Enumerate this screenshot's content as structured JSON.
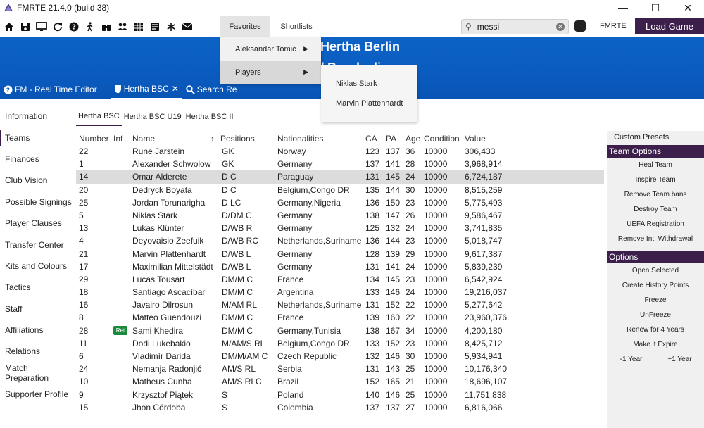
{
  "window": {
    "title": "FMRTE 21.4.0 (build 38)"
  },
  "toolbar": {
    "icons": [
      "home-icon",
      "save-icon",
      "monitor-icon",
      "refresh-icon",
      "help-icon",
      "person-walking-icon",
      "binoculars-icon",
      "group-icon",
      "grid-icon",
      "list-icon",
      "snowflake-icon",
      "mail-icon"
    ],
    "favorites_label": "Favorites",
    "shortlists_label": "Shortlists",
    "search_value": "messi",
    "fmrte_label": "FMRTE",
    "load_game_label": "Load Game"
  },
  "header": {
    "club_name": "Hertha Berlin",
    "league_name": "/ Bundesliga",
    "tabs": [
      {
        "label": "FM - Real Time Editor"
      },
      {
        "label": "Hertha BSC"
      },
      {
        "label": "Search Re"
      }
    ]
  },
  "favorites_menu": {
    "items": [
      {
        "label": "Aleksandar Tomić"
      },
      {
        "label": "Players"
      }
    ],
    "players_submenu": [
      {
        "label": "Niklas Stark"
      },
      {
        "label": "Marvin Plattenhardt"
      }
    ]
  },
  "leftnav": {
    "items": [
      "Information",
      "Teams",
      "Finances",
      "Club Vision",
      "Possible Signings",
      "Player Clauses",
      "Transfer Center",
      "Kits and Colours",
      "Tactics",
      "Staff",
      "Affiliations",
      "Relations",
      "Match Preparation",
      "Supporter Profile"
    ]
  },
  "team_tabs": [
    "Hertha BSC",
    "Hertha BSC U19",
    "Hertha BSC II"
  ],
  "table": {
    "headers": {
      "number": "Number",
      "inf": "Inf",
      "name": "Name",
      "positions": "Positions",
      "nationalities": "Nationalities",
      "ca": "CA",
      "pa": "PA",
      "age": "Age",
      "condition": "Condition",
      "value": "Value"
    },
    "sort_indicator": "↑",
    "rows": [
      {
        "number": "22",
        "inf": "",
        "name": "Rune Jarstein",
        "positions": "GK",
        "nationalities": "Norway",
        "ca": "123",
        "pa": "137",
        "age": "36",
        "condition": "10000",
        "value": "306,433"
      },
      {
        "number": "1",
        "inf": "",
        "name": "Alexander Schwolow",
        "positions": "GK",
        "nationalities": "Germany",
        "ca": "137",
        "pa": "141",
        "age": "28",
        "condition": "10000",
        "value": "3,968,914"
      },
      {
        "number": "14",
        "inf": "",
        "name": "Omar Alderete",
        "positions": "D C",
        "nationalities": "Paraguay",
        "ca": "131",
        "pa": "145",
        "age": "24",
        "condition": "10000",
        "value": "6,724,187"
      },
      {
        "number": "20",
        "inf": "",
        "name": "Dedryck Boyata",
        "positions": "D C",
        "nationalities": "Belgium,Congo DR",
        "ca": "135",
        "pa": "144",
        "age": "30",
        "condition": "10000",
        "value": "8,515,259"
      },
      {
        "number": "25",
        "inf": "",
        "name": "Jordan Torunarigha",
        "positions": "D LC",
        "nationalities": "Germany,Nigeria",
        "ca": "136",
        "pa": "150",
        "age": "23",
        "condition": "10000",
        "value": "5,775,493"
      },
      {
        "number": "5",
        "inf": "",
        "name": "Niklas Stark",
        "positions": "D/DM C",
        "nationalities": "Germany",
        "ca": "138",
        "pa": "147",
        "age": "26",
        "condition": "10000",
        "value": "9,586,467"
      },
      {
        "number": "13",
        "inf": "",
        "name": "Lukas Klünter",
        "positions": "D/WB R",
        "nationalities": "Germany",
        "ca": "125",
        "pa": "132",
        "age": "24",
        "condition": "10000",
        "value": "3,741,835"
      },
      {
        "number": "4",
        "inf": "",
        "name": "Deyovaisio Zeefuik",
        "positions": "D/WB RC",
        "nationalities": "Netherlands,Suriname",
        "ca": "136",
        "pa": "144",
        "age": "23",
        "condition": "10000",
        "value": "5,018,747"
      },
      {
        "number": "21",
        "inf": "",
        "name": "Marvin Plattenhardt",
        "positions": "D/WB L",
        "nationalities": "Germany",
        "ca": "128",
        "pa": "139",
        "age": "29",
        "condition": "10000",
        "value": "9,617,387"
      },
      {
        "number": "17",
        "inf": "",
        "name": "Maximilian Mittelstädt",
        "positions": "D/WB L",
        "nationalities": "Germany",
        "ca": "131",
        "pa": "141",
        "age": "24",
        "condition": "10000",
        "value": "5,839,239"
      },
      {
        "number": "29",
        "inf": "",
        "name": "Lucas Tousart",
        "positions": "DM/M C",
        "nationalities": "France",
        "ca": "134",
        "pa": "145",
        "age": "23",
        "condition": "10000",
        "value": "6,542,924"
      },
      {
        "number": "18",
        "inf": "",
        "name": "Santiago Ascacíbar",
        "positions": "DM/M C",
        "nationalities": "Argentina",
        "ca": "133",
        "pa": "146",
        "age": "24",
        "condition": "10000",
        "value": "19,216,037"
      },
      {
        "number": "16",
        "inf": "",
        "name": "Javairo Dilrosun",
        "positions": "M/AM RL",
        "nationalities": "Netherlands,Suriname",
        "ca": "131",
        "pa": "152",
        "age": "22",
        "condition": "10000",
        "value": "5,277,642"
      },
      {
        "number": "8",
        "inf": "",
        "name": "Matteo Guendouzi",
        "positions": "DM/M C",
        "nationalities": "France",
        "ca": "139",
        "pa": "160",
        "age": "22",
        "condition": "10000",
        "value": "23,960,376"
      },
      {
        "number": "28",
        "inf": "Ret",
        "name": "Sami Khedira",
        "positions": "DM/M C",
        "nationalities": "Germany,Tunisia",
        "ca": "138",
        "pa": "167",
        "age": "34",
        "condition": "10000",
        "value": "4,200,180"
      },
      {
        "number": "11",
        "inf": "",
        "name": "Dodi Lukebakio",
        "positions": "M/AM/S RL",
        "nationalities": "Belgium,Congo DR",
        "ca": "133",
        "pa": "152",
        "age": "23",
        "condition": "10000",
        "value": "8,425,712"
      },
      {
        "number": "6",
        "inf": "",
        "name": "Vladimír Darida",
        "positions": "DM/M/AM C",
        "nationalities": "Czech Republic",
        "ca": "132",
        "pa": "146",
        "age": "30",
        "condition": "10000",
        "value": "5,934,941"
      },
      {
        "number": "24",
        "inf": "",
        "name": "Nemanja Radonjić",
        "positions": "AM/S RL",
        "nationalities": "Serbia",
        "ca": "131",
        "pa": "143",
        "age": "25",
        "condition": "10000",
        "value": "10,176,340"
      },
      {
        "number": "10",
        "inf": "",
        "name": "Matheus Cunha",
        "positions": "AM/S RLC",
        "nationalities": "Brazil",
        "ca": "152",
        "pa": "165",
        "age": "21",
        "condition": "10000",
        "value": "18,696,107"
      },
      {
        "number": "9",
        "inf": "",
        "name": "Krzysztof Piątek",
        "positions": "S",
        "nationalities": "Poland",
        "ca": "140",
        "pa": "146",
        "age": "25",
        "condition": "10000",
        "value": "11,751,838"
      },
      {
        "number": "15",
        "inf": "",
        "name": "Jhon Córdoba",
        "positions": "S",
        "nationalities": "Colombia",
        "ca": "137",
        "pa": "137",
        "age": "27",
        "condition": "10000",
        "value": "6,816,066"
      }
    ],
    "selected_row": 2
  },
  "right_panel": {
    "custom_presets": "Custom Presets",
    "team_options_title": "Team Options",
    "team_options": [
      "Heal Team",
      "Inspire Team",
      "Remove Team bans",
      "Destroy Team",
      "UEFA Registration",
      "Remove Int. Withdrawal"
    ],
    "options_title": "Options",
    "options": [
      "Open Selected",
      "Create History Points",
      "Freeze",
      "UnFreeze",
      "Renew for 4 Years",
      "Make it Expire"
    ],
    "year_minus": "-1 Year",
    "year_plus": "+1 Year"
  },
  "colors": {
    "accent": "#3c1f4a",
    "header_blue": "#0a5bc0",
    "selected_row": "#dcdcdc"
  }
}
